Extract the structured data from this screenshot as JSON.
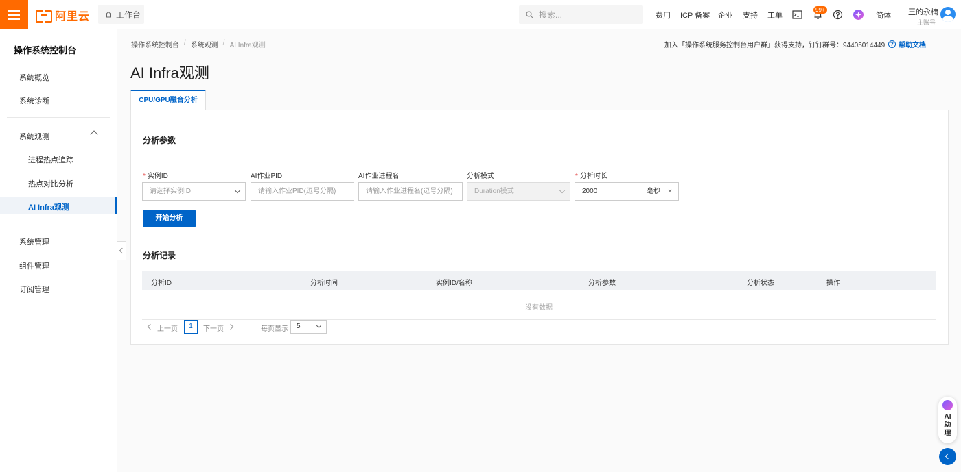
{
  "header": {
    "logo_text": "阿里云",
    "workbench": "工作台",
    "search_placeholder": "搜索...",
    "nav": [
      "费用",
      "ICP 备案",
      "企业",
      "支持",
      "工单"
    ],
    "badge": "99+",
    "lang": "简体",
    "user_name": "王的永楠",
    "user_role": "主账号",
    "accent": "#ff6a00"
  },
  "sidebar": {
    "title": "操作系统控制台",
    "items": [
      "系统概览",
      "系统诊断",
      "系统观测",
      "系统管理",
      "组件管理",
      "订阅管理"
    ],
    "sub_items": [
      "进程热点追踪",
      "热点对比分析",
      "AI Infra观测"
    ]
  },
  "breadcrumb": [
    "操作系统控制台",
    "系统观测",
    "AI Infra观测"
  ],
  "notice": "加入「操作系统服务控制台用户群」获得支持，钉钉群号：94405014449",
  "help_label": "帮助文档",
  "page_title": "AI Infra观测",
  "tab_label": "CPU/GPU融合分析",
  "params": {
    "title": "分析参数",
    "fields": [
      {
        "label": "实例ID",
        "required": true,
        "placeholder": "请选择实例ID"
      },
      {
        "label": "AI作业PID",
        "required": false,
        "placeholder": "请输入作业PID(逗号分隔)"
      },
      {
        "label": "AI作业进程名",
        "required": false,
        "placeholder": "请输入作业进程名(逗号分隔)"
      },
      {
        "label": "分析模式",
        "required": false,
        "placeholder": "Duration模式"
      },
      {
        "label": "分析时长",
        "required": true,
        "value": "2000",
        "unit": "毫秒"
      }
    ],
    "start_button": "开始分析"
  },
  "records": {
    "title": "分析记录",
    "columns": [
      "分析ID",
      "分析时间",
      "实例ID/名称",
      "分析参数",
      "分析状态",
      "操作"
    ],
    "empty_text": "没有数据"
  },
  "pagination": {
    "prev": "上一页",
    "page": "1",
    "next": "下一页",
    "page_size_label": "每页显示",
    "page_size": "5"
  },
  "assistant": {
    "label": "AI助理"
  },
  "primary_color": "#0064c8"
}
